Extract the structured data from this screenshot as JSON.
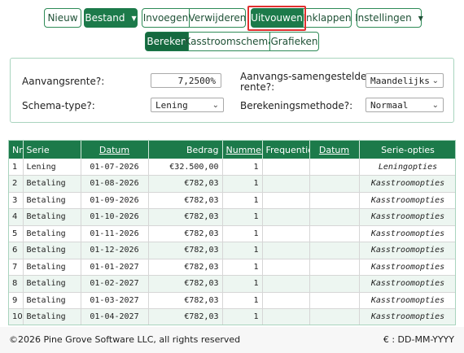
{
  "toolbar": {
    "new": "Nieuw",
    "file": "Bestand",
    "insert": "Invoegen",
    "delete": "Verwijderen",
    "expand": "Uitvouwen",
    "collapse": "Inklappen",
    "settings": "Instellingen"
  },
  "tabs": {
    "calculate": "Bereken",
    "cashflow": "Kasstroomschema",
    "charts": "Grafieken"
  },
  "form": {
    "initial_rate_label": "Aanvangsrente?:",
    "initial_rate_value": "7,2500%",
    "compound_label_1": "Aanvangs-samengestelde",
    "compound_label_2": "rente?:",
    "compound_value": "Maandelijks",
    "schema_label": "Schema-type?:",
    "schema_value": "Lening",
    "method_label": "Berekeningsmethode?:",
    "method_value": "Normaal"
  },
  "table": {
    "headers": [
      "Nr.",
      "Serie",
      "Datum",
      "Bedrag",
      "Nummer",
      "Frequentie",
      "Datum",
      "Serie-opties"
    ],
    "rows": [
      [
        "1",
        "Lening",
        "01-07-2026",
        "€32.500,00",
        "1",
        "",
        "",
        "Leningopties"
      ],
      [
        "2",
        "Betaling",
        "01-08-2026",
        "€782,03",
        "1",
        "",
        "",
        "Kasstroomopties"
      ],
      [
        "3",
        "Betaling",
        "01-09-2026",
        "€782,03",
        "1",
        "",
        "",
        "Kasstroomopties"
      ],
      [
        "4",
        "Betaling",
        "01-10-2026",
        "€782,03",
        "1",
        "",
        "",
        "Kasstroomopties"
      ],
      [
        "5",
        "Betaling",
        "01-11-2026",
        "€782,03",
        "1",
        "",
        "",
        "Kasstroomopties"
      ],
      [
        "6",
        "Betaling",
        "01-12-2026",
        "€782,03",
        "1",
        "",
        "",
        "Kasstroomopties"
      ],
      [
        "7",
        "Betaling",
        "01-01-2027",
        "€782,03",
        "1",
        "",
        "",
        "Kasstroomopties"
      ],
      [
        "8",
        "Betaling",
        "01-02-2027",
        "€782,03",
        "1",
        "",
        "",
        "Kasstroomopties"
      ],
      [
        "9",
        "Betaling",
        "01-03-2027",
        "€782,03",
        "1",
        "",
        "",
        "Kasstroomopties"
      ],
      [
        "10",
        "Betaling",
        "01-04-2027",
        "€782,03",
        "1",
        "",
        "",
        "Kasstroomopties"
      ]
    ]
  },
  "footer": {
    "copyright": "©2026 Pine Grove Software LLC, all rights reserved",
    "format": "€ : DD-MM-YYYY"
  },
  "colors": {
    "accent": "#1c7a4a",
    "highlight": "#e02f2f",
    "row_alt": "#edf6f1"
  }
}
